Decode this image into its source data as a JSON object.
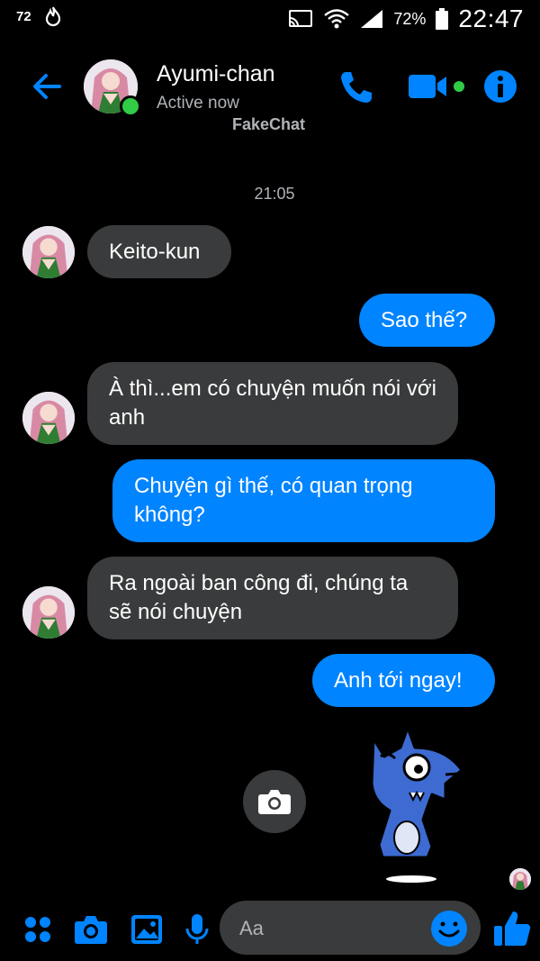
{
  "status_bar": {
    "left_badge": "72",
    "battery_pct": "72%",
    "time": "22:47"
  },
  "header": {
    "contact_name": "Ayumi-chan",
    "status": "Active now",
    "watermark": "FakeChat"
  },
  "conversation": {
    "timestamp": "21:05",
    "messages": [
      {
        "direction": "incoming",
        "text": "Keito-kun"
      },
      {
        "direction": "outgoing",
        "text": "Sao thế?"
      },
      {
        "direction": "incoming",
        "text": "À thì...em có chuyện muốn nói với anh"
      },
      {
        "direction": "outgoing",
        "text": "Chuyện gì thế, có quan trọng không?"
      },
      {
        "direction": "incoming",
        "text": "Ra ngoài ban công đi, chúng ta sẽ nói chuyện"
      },
      {
        "direction": "outgoing",
        "text": "Anh tới ngay!"
      }
    ]
  },
  "composer": {
    "placeholder": "Aa"
  },
  "colors": {
    "accent": "#0084ff",
    "incoming_bubble": "#3a3b3c",
    "online": "#31cc46",
    "background": "#000000"
  },
  "icons": [
    "back-arrow-icon",
    "phone-icon",
    "video-camera-icon",
    "info-icon",
    "apps-icon",
    "camera-icon",
    "gallery-icon",
    "microphone-icon",
    "emoji-icon",
    "thumbs-up-icon"
  ]
}
